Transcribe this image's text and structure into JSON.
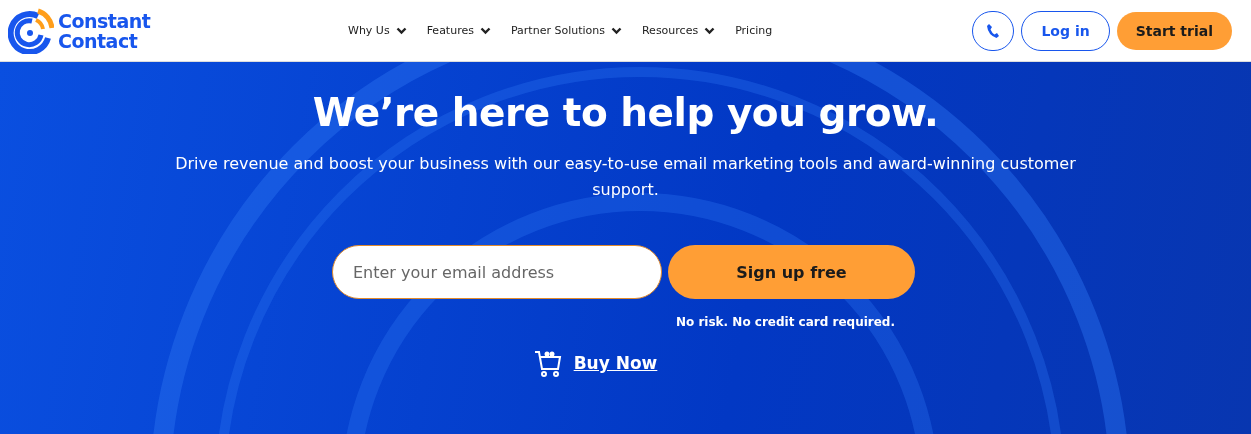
{
  "logo": {
    "lines": [
      "Constant",
      "Contact"
    ]
  },
  "nav": [
    {
      "label": "Why Us",
      "dropdown": true
    },
    {
      "label": "Features",
      "dropdown": true
    },
    {
      "label": "Partner Solutions",
      "dropdown": true
    },
    {
      "label": "Resources",
      "dropdown": true
    },
    {
      "label": "Pricing",
      "dropdown": false
    }
  ],
  "header_buttons": {
    "login": "Log in",
    "trial": "Start trial"
  },
  "hero": {
    "title": "We’re here to help you grow.",
    "subtitle": "Drive revenue and boost your business with our easy-to-use email marketing tools and award-winning customer support.",
    "email": {
      "placeholder": "Enter your email address"
    },
    "signup": "Sign up free",
    "note": "No risk. No credit card required.",
    "buy": "Buy Now"
  }
}
